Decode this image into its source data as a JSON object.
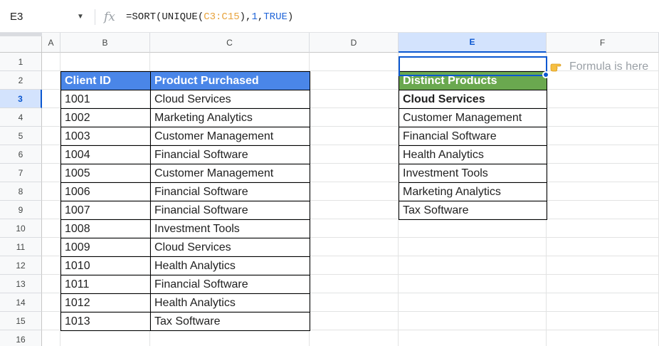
{
  "formula_bar": {
    "cell_ref": "E3",
    "fx_label": "fx",
    "formula_parts": [
      {
        "text": "=SORT(UNIQUE(",
        "kind": "plain"
      },
      {
        "text": "C3:C15",
        "kind": "range"
      },
      {
        "text": "),",
        "kind": "plain"
      },
      {
        "text": "1",
        "kind": "num"
      },
      {
        "text": ",",
        "kind": "plain"
      },
      {
        "text": "TRUE",
        "kind": "bool"
      },
      {
        "text": ")",
        "kind": "plain"
      }
    ]
  },
  "columns": [
    "A",
    "B",
    "C",
    "D",
    "E",
    "F"
  ],
  "selected_column": "E",
  "rows": [
    "1",
    "2",
    "3",
    "4",
    "5",
    "6",
    "7",
    "8",
    "9",
    "10",
    "11",
    "12",
    "13",
    "14",
    "15",
    "16"
  ],
  "selected_row": "3",
  "client_table": {
    "headers": [
      "Client ID",
      "Product Purchased"
    ],
    "rows": [
      [
        "1001",
        "Cloud Services"
      ],
      [
        "1002",
        "Marketing Analytics"
      ],
      [
        "1003",
        "Customer Management"
      ],
      [
        "1004",
        "Financial Software"
      ],
      [
        "1005",
        "Customer Management"
      ],
      [
        "1006",
        "Financial Software"
      ],
      [
        "1007",
        "Financial Software"
      ],
      [
        "1008",
        "Investment Tools"
      ],
      [
        "1009",
        "Cloud Services"
      ],
      [
        "1010",
        "Health Analytics"
      ],
      [
        "1011",
        "Financial Software"
      ],
      [
        "1012",
        "Health Analytics"
      ],
      [
        "1013",
        "Tax Software"
      ]
    ]
  },
  "distinct_table": {
    "header": "Distinct Products",
    "values": [
      "Cloud Services",
      "Customer Management",
      "Financial Software",
      "Health Analytics",
      "Investment Tools",
      "Marketing Analytics",
      "Tax Software"
    ]
  },
  "note": {
    "icon": "pointing-hand-icon",
    "text": "Formula is here"
  },
  "colors": {
    "blue_header": "#4a86e8",
    "green_header": "#6aa84f",
    "selection": "#0b57d0",
    "formula_range": "#e8a33d",
    "formula_literal": "#1f64d8"
  }
}
